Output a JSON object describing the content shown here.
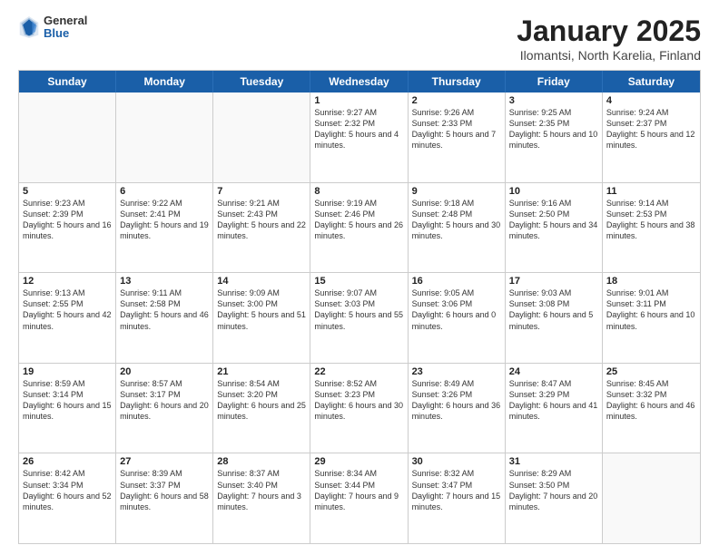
{
  "logo": {
    "general": "General",
    "blue": "Blue"
  },
  "title": "January 2025",
  "subtitle": "Ilomantsi, North Karelia, Finland",
  "header_days": [
    "Sunday",
    "Monday",
    "Tuesday",
    "Wednesday",
    "Thursday",
    "Friday",
    "Saturday"
  ],
  "weeks": [
    [
      {
        "day": "",
        "sunrise": "",
        "sunset": "",
        "daylight": ""
      },
      {
        "day": "",
        "sunrise": "",
        "sunset": "",
        "daylight": ""
      },
      {
        "day": "",
        "sunrise": "",
        "sunset": "",
        "daylight": ""
      },
      {
        "day": "1",
        "sunrise": "Sunrise: 9:27 AM",
        "sunset": "Sunset: 2:32 PM",
        "daylight": "Daylight: 5 hours and 4 minutes."
      },
      {
        "day": "2",
        "sunrise": "Sunrise: 9:26 AM",
        "sunset": "Sunset: 2:33 PM",
        "daylight": "Daylight: 5 hours and 7 minutes."
      },
      {
        "day": "3",
        "sunrise": "Sunrise: 9:25 AM",
        "sunset": "Sunset: 2:35 PM",
        "daylight": "Daylight: 5 hours and 10 minutes."
      },
      {
        "day": "4",
        "sunrise": "Sunrise: 9:24 AM",
        "sunset": "Sunset: 2:37 PM",
        "daylight": "Daylight: 5 hours and 12 minutes."
      }
    ],
    [
      {
        "day": "5",
        "sunrise": "Sunrise: 9:23 AM",
        "sunset": "Sunset: 2:39 PM",
        "daylight": "Daylight: 5 hours and 16 minutes."
      },
      {
        "day": "6",
        "sunrise": "Sunrise: 9:22 AM",
        "sunset": "Sunset: 2:41 PM",
        "daylight": "Daylight: 5 hours and 19 minutes."
      },
      {
        "day": "7",
        "sunrise": "Sunrise: 9:21 AM",
        "sunset": "Sunset: 2:43 PM",
        "daylight": "Daylight: 5 hours and 22 minutes."
      },
      {
        "day": "8",
        "sunrise": "Sunrise: 9:19 AM",
        "sunset": "Sunset: 2:46 PM",
        "daylight": "Daylight: 5 hours and 26 minutes."
      },
      {
        "day": "9",
        "sunrise": "Sunrise: 9:18 AM",
        "sunset": "Sunset: 2:48 PM",
        "daylight": "Daylight: 5 hours and 30 minutes."
      },
      {
        "day": "10",
        "sunrise": "Sunrise: 9:16 AM",
        "sunset": "Sunset: 2:50 PM",
        "daylight": "Daylight: 5 hours and 34 minutes."
      },
      {
        "day": "11",
        "sunrise": "Sunrise: 9:14 AM",
        "sunset": "Sunset: 2:53 PM",
        "daylight": "Daylight: 5 hours and 38 minutes."
      }
    ],
    [
      {
        "day": "12",
        "sunrise": "Sunrise: 9:13 AM",
        "sunset": "Sunset: 2:55 PM",
        "daylight": "Daylight: 5 hours and 42 minutes."
      },
      {
        "day": "13",
        "sunrise": "Sunrise: 9:11 AM",
        "sunset": "Sunset: 2:58 PM",
        "daylight": "Daylight: 5 hours and 46 minutes."
      },
      {
        "day": "14",
        "sunrise": "Sunrise: 9:09 AM",
        "sunset": "Sunset: 3:00 PM",
        "daylight": "Daylight: 5 hours and 51 minutes."
      },
      {
        "day": "15",
        "sunrise": "Sunrise: 9:07 AM",
        "sunset": "Sunset: 3:03 PM",
        "daylight": "Daylight: 5 hours and 55 minutes."
      },
      {
        "day": "16",
        "sunrise": "Sunrise: 9:05 AM",
        "sunset": "Sunset: 3:06 PM",
        "daylight": "Daylight: 6 hours and 0 minutes."
      },
      {
        "day": "17",
        "sunrise": "Sunrise: 9:03 AM",
        "sunset": "Sunset: 3:08 PM",
        "daylight": "Daylight: 6 hours and 5 minutes."
      },
      {
        "day": "18",
        "sunrise": "Sunrise: 9:01 AM",
        "sunset": "Sunset: 3:11 PM",
        "daylight": "Daylight: 6 hours and 10 minutes."
      }
    ],
    [
      {
        "day": "19",
        "sunrise": "Sunrise: 8:59 AM",
        "sunset": "Sunset: 3:14 PM",
        "daylight": "Daylight: 6 hours and 15 minutes."
      },
      {
        "day": "20",
        "sunrise": "Sunrise: 8:57 AM",
        "sunset": "Sunset: 3:17 PM",
        "daylight": "Daylight: 6 hours and 20 minutes."
      },
      {
        "day": "21",
        "sunrise": "Sunrise: 8:54 AM",
        "sunset": "Sunset: 3:20 PM",
        "daylight": "Daylight: 6 hours and 25 minutes."
      },
      {
        "day": "22",
        "sunrise": "Sunrise: 8:52 AM",
        "sunset": "Sunset: 3:23 PM",
        "daylight": "Daylight: 6 hours and 30 minutes."
      },
      {
        "day": "23",
        "sunrise": "Sunrise: 8:49 AM",
        "sunset": "Sunset: 3:26 PM",
        "daylight": "Daylight: 6 hours and 36 minutes."
      },
      {
        "day": "24",
        "sunrise": "Sunrise: 8:47 AM",
        "sunset": "Sunset: 3:29 PM",
        "daylight": "Daylight: 6 hours and 41 minutes."
      },
      {
        "day": "25",
        "sunrise": "Sunrise: 8:45 AM",
        "sunset": "Sunset: 3:32 PM",
        "daylight": "Daylight: 6 hours and 46 minutes."
      }
    ],
    [
      {
        "day": "26",
        "sunrise": "Sunrise: 8:42 AM",
        "sunset": "Sunset: 3:34 PM",
        "daylight": "Daylight: 6 hours and 52 minutes."
      },
      {
        "day": "27",
        "sunrise": "Sunrise: 8:39 AM",
        "sunset": "Sunset: 3:37 PM",
        "daylight": "Daylight: 6 hours and 58 minutes."
      },
      {
        "day": "28",
        "sunrise": "Sunrise: 8:37 AM",
        "sunset": "Sunset: 3:40 PM",
        "daylight": "Daylight: 7 hours and 3 minutes."
      },
      {
        "day": "29",
        "sunrise": "Sunrise: 8:34 AM",
        "sunset": "Sunset: 3:44 PM",
        "daylight": "Daylight: 7 hours and 9 minutes."
      },
      {
        "day": "30",
        "sunrise": "Sunrise: 8:32 AM",
        "sunset": "Sunset: 3:47 PM",
        "daylight": "Daylight: 7 hours and 15 minutes."
      },
      {
        "day": "31",
        "sunrise": "Sunrise: 8:29 AM",
        "sunset": "Sunset: 3:50 PM",
        "daylight": "Daylight: 7 hours and 20 minutes."
      },
      {
        "day": "",
        "sunrise": "",
        "sunset": "",
        "daylight": ""
      }
    ]
  ]
}
